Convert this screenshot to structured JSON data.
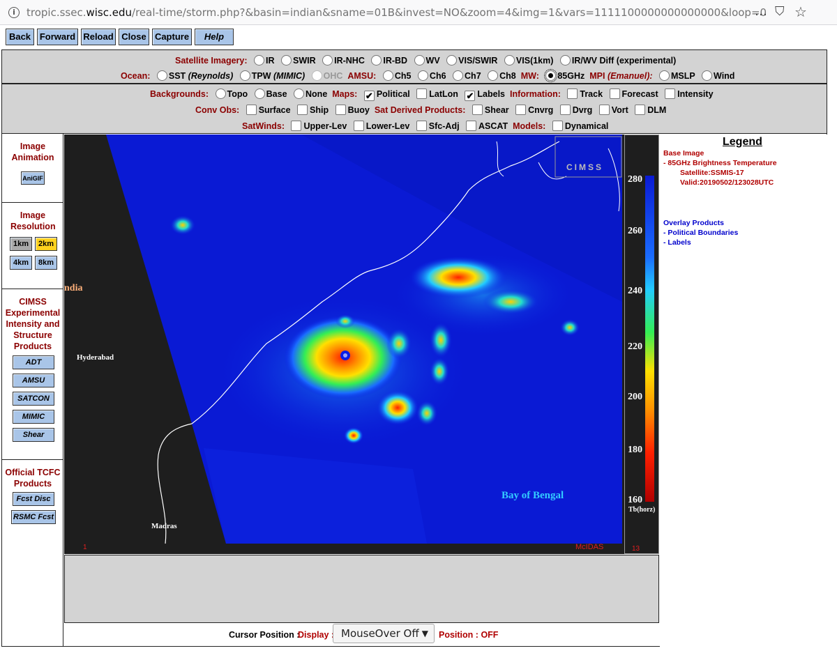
{
  "browser": {
    "url_host_prefix": "tropic.ssec.",
    "url_host": "wisc.edu",
    "url_rest": "/real-time/storm.php?&basin=indian&sname=01B&invest=NO&zoom=4&img=1&vars=1111100000000000000&loop=0",
    "more_icon": "…",
    "pocket_icon": "⛉",
    "star_icon": "☆",
    "info_icon": "i"
  },
  "nav": {
    "back": "Back",
    "forward": "Forward",
    "reload": "Reload",
    "close": "Close",
    "capture": "Capture",
    "help": "Help"
  },
  "sat": {
    "label": "Satellite Imagery:",
    "items": [
      "IR",
      "SWIR",
      "IR-NHC",
      "IR-BD",
      "WV",
      "VIS/SWIR",
      "VIS(1km)",
      "IR/WV Diff (experimental)"
    ]
  },
  "ocean": {
    "label": "Ocean:",
    "sst": "SST",
    "sst_src": "(Reynolds)",
    "tpw": "TPW",
    "tpw_src": "(MIMIC)",
    "ohc": "OHC",
    "amsu_label": "AMSU:",
    "amsu": [
      "Ch5",
      "Ch6",
      "Ch7",
      "Ch8"
    ],
    "mw_label": "MW:",
    "mw": "85GHz",
    "mpi_label": "MPI",
    "mpi_src": "(Emanuel):",
    "mpi": [
      "MSLP",
      "Wind"
    ]
  },
  "bg": {
    "label": "Backgrounds:",
    "items": [
      "Topo",
      "Base",
      "None"
    ],
    "maps_label": "Maps:",
    "maps": [
      "Political",
      "LatLon",
      "Labels"
    ],
    "info_label": "Information:",
    "info": [
      "Track",
      "Forecast",
      "Intensity"
    ]
  },
  "conv": {
    "label": "Conv Obs:",
    "items": [
      "Surface",
      "Ship",
      "Buoy"
    ],
    "sdp_label": "Sat Derived Products:",
    "sdp": [
      "Shear",
      "Cnvrg",
      "Dvrg",
      "Vort",
      "DLM"
    ]
  },
  "winds": {
    "label": "SatWinds:",
    "items": [
      "Upper-Lev",
      "Lower-Lev",
      "Sfc-Adj",
      "ASCAT"
    ],
    "models_label": "Models:",
    "models": "Dynamical"
  },
  "side": {
    "anim_title": "Image Animation",
    "anigif": "AniGIF",
    "res_title": "Image Resolution",
    "res": [
      "1km",
      "2km",
      "4km",
      "8km"
    ],
    "cimss_title": "CIMSS Experimental Intensity and Structure Products",
    "cimss": [
      "ADT",
      "AMSU",
      "SATCON",
      "MIMIC",
      "Shear"
    ],
    "tcfc_title": "Official TCFC Products",
    "tcfc": [
      "Fcst Disc",
      "RSMC Fcst"
    ]
  },
  "image": {
    "india": "ndia",
    "hyderabad": "Hyderabad",
    "madras": "Madras",
    "bay": "Bay of Bengal",
    "mcidas": "McIDAS",
    "frame": "1",
    "cbar_frame": "13",
    "cbar_unit": "Tb(horz)",
    "cbar_ticks": [
      "280",
      "260",
      "240",
      "220",
      "200",
      "180",
      "160"
    ],
    "logo": "CIMSS"
  },
  "legend": {
    "title": "Legend",
    "base_title": "Base Image",
    "base_item": "-  85GHz Brightness Temperature",
    "satellite": "Satellite:SSMIS-17",
    "valid": "Valid:20190502/123028UTC",
    "overlay_title": "Overlay Products",
    "overlay": [
      "-  Political Boundaries",
      "-  Labels"
    ]
  },
  "cursor": {
    "label": "Cursor Position :",
    "display_label": "Display :",
    "select": "MouseOver Off",
    "position_label": "Position :",
    "position": "OFF"
  },
  "colors": {
    "label_red": "#8b0000",
    "button_blue": "#a9c5e8",
    "selected": "#ffd21f",
    "panel_gray": "#d3d3d3",
    "overlay_blue": "#0000cc",
    "bay_label": "#33ccff"
  }
}
